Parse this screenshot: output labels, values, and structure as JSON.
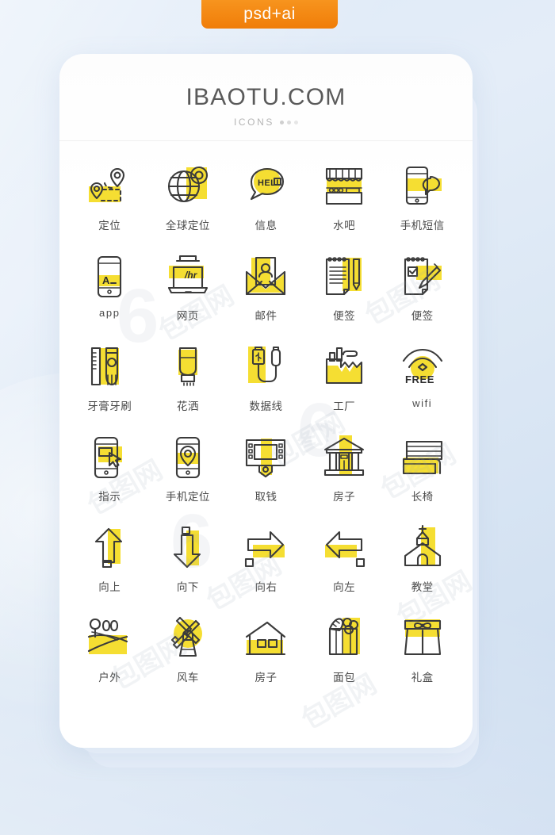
{
  "badge": {
    "label": "psd+ai",
    "color": "#f5881f"
  },
  "card": {
    "brand": "IBAOTU.COM",
    "subtitle": "ICONS"
  },
  "theme": {
    "accent_yellow": "#f5de32",
    "stroke": "#3b3b3b",
    "background_blue": "#dde9f7",
    "label_color": "#4a4a4a"
  },
  "icons": [
    {
      "label": "定位",
      "name": "location-pin-route-icon",
      "latin": false,
      "inner_text": ""
    },
    {
      "label": "全球定位",
      "name": "globe-location-icon",
      "latin": false,
      "inner_text": ""
    },
    {
      "label": "信息",
      "name": "message-bubble-icon",
      "latin": false,
      "inner_text": "HELLO"
    },
    {
      "label": "水吧",
      "name": "water-bar-shop-icon",
      "latin": false,
      "inner_text": ""
    },
    {
      "label": "手机短信",
      "name": "phone-sms-icon",
      "latin": false,
      "inner_text": ""
    },
    {
      "label": "app",
      "name": "app-phone-icon",
      "latin": true,
      "inner_text": "A_"
    },
    {
      "label": "网页",
      "name": "webpage-laptop-icon",
      "latin": false,
      "inner_text": "/hr"
    },
    {
      "label": "邮件",
      "name": "mail-envelope-icon",
      "latin": false,
      "inner_text": ""
    },
    {
      "label": "便签",
      "name": "notepad-pencil-icon",
      "latin": false,
      "inner_text": ""
    },
    {
      "label": "便签",
      "name": "checklist-pencil-icon",
      "latin": false,
      "inner_text": ""
    },
    {
      "label": "牙膏牙刷",
      "name": "toothpaste-toothbrush-icon",
      "latin": false,
      "inner_text": ""
    },
    {
      "label": "花洒",
      "name": "shower-head-icon",
      "latin": false,
      "inner_text": ""
    },
    {
      "label": "数据线",
      "name": "usb-data-cable-icon",
      "latin": false,
      "inner_text": ""
    },
    {
      "label": "工厂",
      "name": "factory-icon",
      "latin": false,
      "inner_text": ""
    },
    {
      "label": "wifi",
      "name": "free-wifi-icon",
      "latin": true,
      "inner_text": "FREE"
    },
    {
      "label": "指示",
      "name": "phone-tap-pointer-icon",
      "latin": false,
      "inner_text": ""
    },
    {
      "label": "手机定位",
      "name": "phone-location-icon",
      "latin": false,
      "inner_text": ""
    },
    {
      "label": "取钱",
      "name": "atm-withdraw-icon",
      "latin": false,
      "inner_text": ""
    },
    {
      "label": "房子",
      "name": "bank-building-icon",
      "latin": false,
      "inner_text": ""
    },
    {
      "label": "长椅",
      "name": "park-bench-icon",
      "latin": false,
      "inner_text": ""
    },
    {
      "label": "向上",
      "name": "arrow-up-icon",
      "latin": false,
      "inner_text": ""
    },
    {
      "label": "向下",
      "name": "arrow-down-icon",
      "latin": false,
      "inner_text": ""
    },
    {
      "label": "向右",
      "name": "arrow-right-icon",
      "latin": false,
      "inner_text": ""
    },
    {
      "label": "向左",
      "name": "arrow-left-icon",
      "latin": false,
      "inner_text": ""
    },
    {
      "label": "教堂",
      "name": "church-icon",
      "latin": false,
      "inner_text": ""
    },
    {
      "label": "户外",
      "name": "outdoor-field-icon",
      "latin": false,
      "inner_text": ""
    },
    {
      "label": "风车",
      "name": "windmill-icon",
      "latin": false,
      "inner_text": ""
    },
    {
      "label": "房子",
      "name": "house-icon",
      "latin": false,
      "inner_text": ""
    },
    {
      "label": "面包",
      "name": "bread-bag-icon",
      "latin": false,
      "inner_text": ""
    },
    {
      "label": "礼盒",
      "name": "gift-box-icon",
      "latin": false,
      "inner_text": ""
    }
  ],
  "watermark": {
    "text": "包图网",
    "mark": "6"
  }
}
